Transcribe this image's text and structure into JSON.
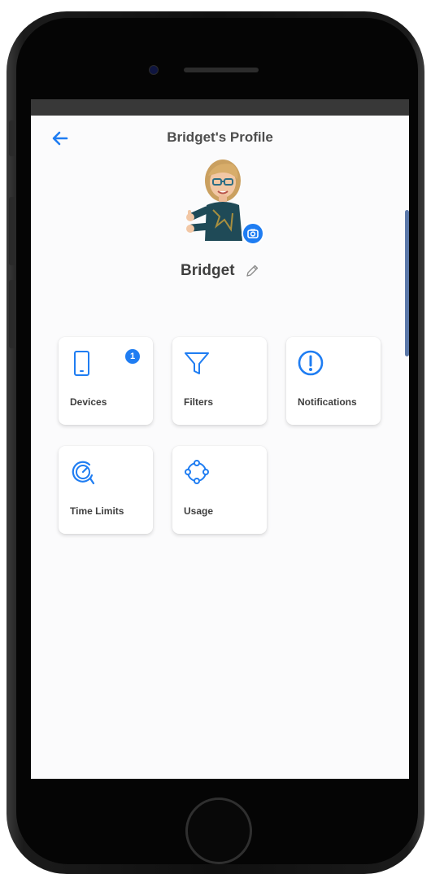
{
  "header": {
    "title": "Bridget's Profile"
  },
  "profile": {
    "name": "Bridget"
  },
  "tiles": [
    {
      "label": "Devices",
      "icon": "phone-icon",
      "badge": "1"
    },
    {
      "label": "Filters",
      "icon": "filter-icon"
    },
    {
      "label": "Notifications",
      "icon": "alert-icon"
    },
    {
      "label": "Time Limits",
      "icon": "timer-icon"
    },
    {
      "label": "Usage",
      "icon": "usage-icon"
    }
  ],
  "colors": {
    "accent": "#1f7df2",
    "text": "#3f3f3f",
    "background": "#fbfbfc"
  }
}
